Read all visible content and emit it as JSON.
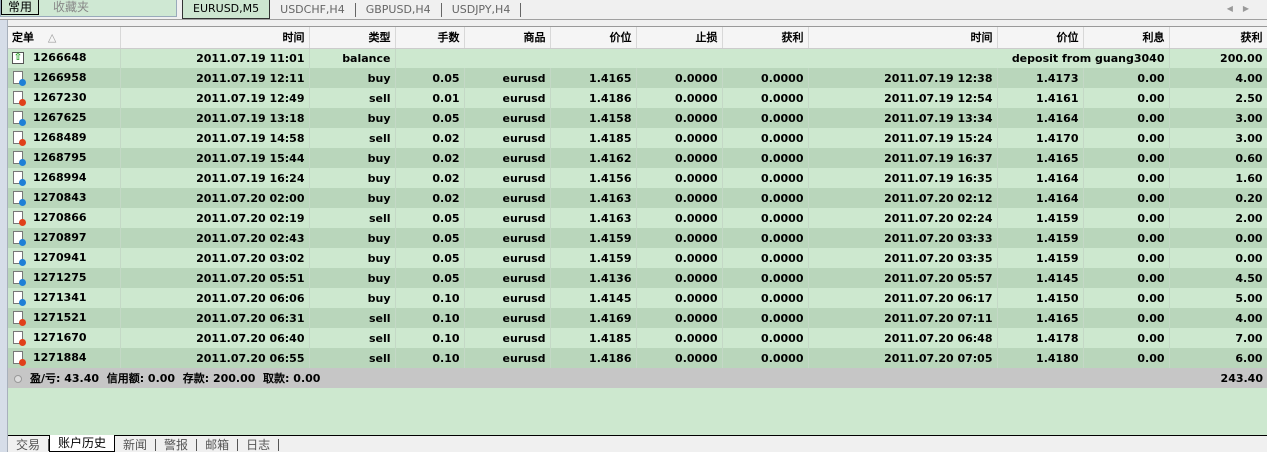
{
  "left_tabs": [
    "常用",
    "收藏夹"
  ],
  "chart_tabs": [
    "EURUSD,M5",
    "USDCHF,H4",
    "GBPUSD,H4",
    "USDJPY,H4"
  ],
  "columns": [
    "定单",
    "时间",
    "类型",
    "手数",
    "商品",
    "价位",
    "止损",
    "获利",
    "时间",
    "价位",
    "利息",
    "获利"
  ],
  "sort_indicator": "△",
  "balance_row": {
    "order": "1266648",
    "time": "2011.07.19 11:01",
    "type": "balance",
    "comment": "deposit from guang3040",
    "profit": "200.00"
  },
  "rows": [
    {
      "order": "1266958",
      "open_time": "2011.07.19 12:11",
      "type": "buy",
      "lots": "0.05",
      "symbol": "eurusd",
      "open_price": "1.4165",
      "sl": "0.0000",
      "tp": "0.0000",
      "close_time": "2011.07.19 12:38",
      "close_price": "1.4173",
      "swap": "0.00",
      "profit": "4.00"
    },
    {
      "order": "1267230",
      "open_time": "2011.07.19 12:49",
      "type": "sell",
      "lots": "0.01",
      "symbol": "eurusd",
      "open_price": "1.4186",
      "sl": "0.0000",
      "tp": "0.0000",
      "close_time": "2011.07.19 12:54",
      "close_price": "1.4161",
      "swap": "0.00",
      "profit": "2.50"
    },
    {
      "order": "1267625",
      "open_time": "2011.07.19 13:18",
      "type": "buy",
      "lots": "0.05",
      "symbol": "eurusd",
      "open_price": "1.4158",
      "sl": "0.0000",
      "tp": "0.0000",
      "close_time": "2011.07.19 13:34",
      "close_price": "1.4164",
      "swap": "0.00",
      "profit": "3.00"
    },
    {
      "order": "1268489",
      "open_time": "2011.07.19 14:58",
      "type": "sell",
      "lots": "0.02",
      "symbol": "eurusd",
      "open_price": "1.4185",
      "sl": "0.0000",
      "tp": "0.0000",
      "close_time": "2011.07.19 15:24",
      "close_price": "1.4170",
      "swap": "0.00",
      "profit": "3.00"
    },
    {
      "order": "1268795",
      "open_time": "2011.07.19 15:44",
      "type": "buy",
      "lots": "0.02",
      "symbol": "eurusd",
      "open_price": "1.4162",
      "sl": "0.0000",
      "tp": "0.0000",
      "close_time": "2011.07.19 16:37",
      "close_price": "1.4165",
      "swap": "0.00",
      "profit": "0.60"
    },
    {
      "order": "1268994",
      "open_time": "2011.07.19 16:24",
      "type": "buy",
      "lots": "0.02",
      "symbol": "eurusd",
      "open_price": "1.4156",
      "sl": "0.0000",
      "tp": "0.0000",
      "close_time": "2011.07.19 16:35",
      "close_price": "1.4164",
      "swap": "0.00",
      "profit": "1.60"
    },
    {
      "order": "1270843",
      "open_time": "2011.07.20 02:00",
      "type": "buy",
      "lots": "0.02",
      "symbol": "eurusd",
      "open_price": "1.4163",
      "sl": "0.0000",
      "tp": "0.0000",
      "close_time": "2011.07.20 02:12",
      "close_price": "1.4164",
      "swap": "0.00",
      "profit": "0.20"
    },
    {
      "order": "1270866",
      "open_time": "2011.07.20 02:19",
      "type": "sell",
      "lots": "0.05",
      "symbol": "eurusd",
      "open_price": "1.4163",
      "sl": "0.0000",
      "tp": "0.0000",
      "close_time": "2011.07.20 02:24",
      "close_price": "1.4159",
      "swap": "0.00",
      "profit": "2.00"
    },
    {
      "order": "1270897",
      "open_time": "2011.07.20 02:43",
      "type": "buy",
      "lots": "0.05",
      "symbol": "eurusd",
      "open_price": "1.4159",
      "sl": "0.0000",
      "tp": "0.0000",
      "close_time": "2011.07.20 03:33",
      "close_price": "1.4159",
      "swap": "0.00",
      "profit": "0.00"
    },
    {
      "order": "1270941",
      "open_time": "2011.07.20 03:02",
      "type": "buy",
      "lots": "0.05",
      "symbol": "eurusd",
      "open_price": "1.4159",
      "sl": "0.0000",
      "tp": "0.0000",
      "close_time": "2011.07.20 03:35",
      "close_price": "1.4159",
      "swap": "0.00",
      "profit": "0.00"
    },
    {
      "order": "1271275",
      "open_time": "2011.07.20 05:51",
      "type": "buy",
      "lots": "0.05",
      "symbol": "eurusd",
      "open_price": "1.4136",
      "sl": "0.0000",
      "tp": "0.0000",
      "close_time": "2011.07.20 05:57",
      "close_price": "1.4145",
      "swap": "0.00",
      "profit": "4.50"
    },
    {
      "order": "1271341",
      "open_time": "2011.07.20 06:06",
      "type": "buy",
      "lots": "0.10",
      "symbol": "eurusd",
      "open_price": "1.4145",
      "sl": "0.0000",
      "tp": "0.0000",
      "close_time": "2011.07.20 06:17",
      "close_price": "1.4150",
      "swap": "0.00",
      "profit": "5.00"
    },
    {
      "order": "1271521",
      "open_time": "2011.07.20 06:31",
      "type": "sell",
      "lots": "0.10",
      "symbol": "eurusd",
      "open_price": "1.4169",
      "sl": "0.0000",
      "tp": "0.0000",
      "close_time": "2011.07.20 07:11",
      "close_price": "1.4165",
      "swap": "0.00",
      "profit": "4.00"
    },
    {
      "order": "1271670",
      "open_time": "2011.07.20 06:40",
      "type": "sell",
      "lots": "0.10",
      "symbol": "eurusd",
      "open_price": "1.4185",
      "sl": "0.0000",
      "tp": "0.0000",
      "close_time": "2011.07.20 06:48",
      "close_price": "1.4178",
      "swap": "0.00",
      "profit": "7.00"
    },
    {
      "order": "1271884",
      "open_time": "2011.07.20 06:55",
      "type": "sell",
      "lots": "0.10",
      "symbol": "eurusd",
      "open_price": "1.4186",
      "sl": "0.0000",
      "tp": "0.0000",
      "close_time": "2011.07.20 07:05",
      "close_price": "1.4180",
      "swap": "0.00",
      "profit": "6.00"
    }
  ],
  "summary": {
    "text": "盈/亏: 43.40  信用额: 0.00  存款: 200.00  取款: 0.00",
    "total": "243.40"
  },
  "bottom_tabs": [
    "交易",
    "账户历史",
    "新闻",
    "警报",
    "邮箱",
    "日志"
  ],
  "colors": {
    "row_light": "#cde8cf",
    "row_dark": "#b9d6bb",
    "buy_dot": "#1e7fd6",
    "sell_dot": "#e0401a"
  }
}
